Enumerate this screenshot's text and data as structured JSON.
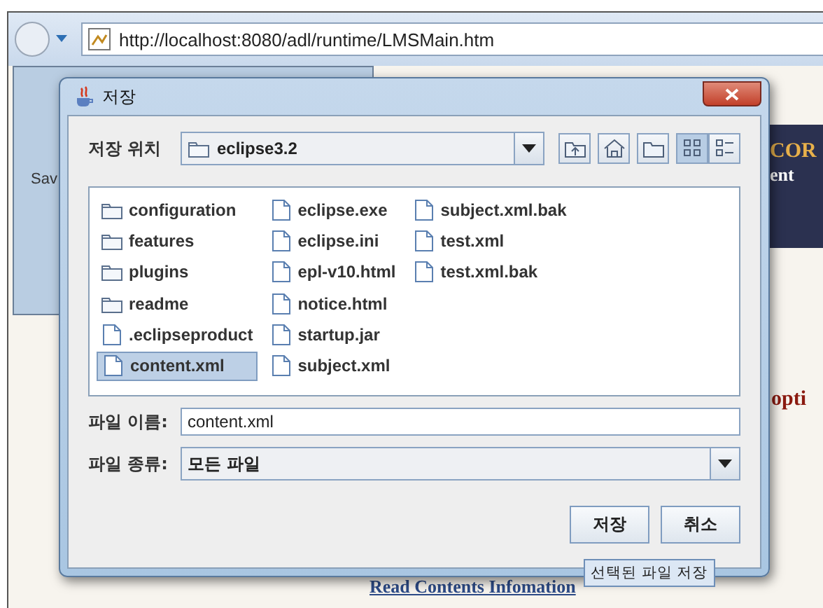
{
  "browser": {
    "url": "http://localhost:8080/adl/runtime/LMSMain.htm"
  },
  "background": {
    "back_window_text": "Sav",
    "banner_text": "COR",
    "banner_subtext": "ent",
    "heading_fragment": "opti",
    "link": "Read Contents Infomation"
  },
  "dialog": {
    "title": "저장",
    "save_in_label": "저장 위치",
    "save_in_value": "eclipse3.2",
    "tool_buttons": [
      {
        "kind": "up"
      },
      {
        "kind": "home"
      },
      {
        "kind": "new-folder"
      }
    ],
    "view_buttons": [
      {
        "kind": "list",
        "selected": true
      },
      {
        "kind": "details",
        "selected": false
      }
    ],
    "files": [
      {
        "name": "configuration",
        "kind": "folder",
        "selected": false
      },
      {
        "name": "features",
        "kind": "folder",
        "selected": false
      },
      {
        "name": "plugins",
        "kind": "folder",
        "selected": false
      },
      {
        "name": "readme",
        "kind": "folder",
        "selected": false
      },
      {
        "name": ".eclipseproduct",
        "kind": "file",
        "selected": false
      },
      {
        "name": "content.xml",
        "kind": "file",
        "selected": true
      },
      {
        "name": "eclipse.exe",
        "kind": "file",
        "selected": false
      },
      {
        "name": "eclipse.ini",
        "kind": "file",
        "selected": false
      },
      {
        "name": "epl-v10.html",
        "kind": "file",
        "selected": false
      },
      {
        "name": "notice.html",
        "kind": "file",
        "selected": false
      },
      {
        "name": "startup.jar",
        "kind": "file",
        "selected": false
      },
      {
        "name": "subject.xml",
        "kind": "file",
        "selected": false
      },
      {
        "name": "subject.xml.bak",
        "kind": "file",
        "selected": false
      },
      {
        "name": "test.xml",
        "kind": "file",
        "selected": false
      },
      {
        "name": "test.xml.bak",
        "kind": "file",
        "selected": false
      }
    ],
    "file_name_label": "파일 이름:",
    "file_name": "content.xml",
    "file_type_label": "파일 종류:",
    "file_type": "모든 파일",
    "buttons": [
      "저장",
      "취소"
    ],
    "tooltip": "선택된 파일 저장"
  }
}
